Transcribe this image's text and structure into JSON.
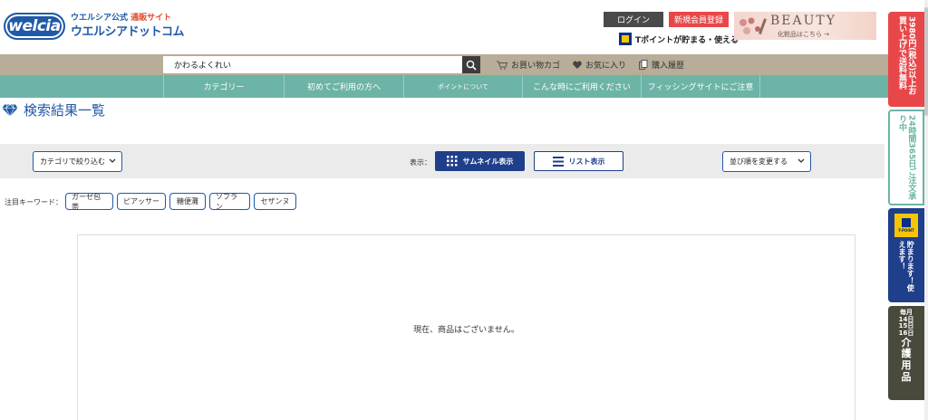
{
  "header": {
    "logo_badge": "welcia",
    "logo_sub_a": "ウエルシア公式",
    "logo_sub_b": "通販サイト",
    "logo_main": "ウエルシアドットコム",
    "login": "ログイン",
    "register": "新規会員登録",
    "tpoint": "Tポイントが貯まる・使える",
    "beauty_title": "BEAUTY",
    "beauty_sub": "化粧品はこちら →"
  },
  "search": {
    "value": "かわるよくれい",
    "cart": "お買い物カゴ",
    "favorites": "お気に入り",
    "history": "購入履歴"
  },
  "nav": {
    "items": [
      {
        "label": "カテゴリー"
      },
      {
        "label": "初めてご利用の方へ"
      },
      {
        "label": "ポイントについて"
      },
      {
        "label": "こんな時にご利用ください"
      },
      {
        "label": "フィッシングサイトにご注意"
      }
    ]
  },
  "main": {
    "title": "検索結果一覧",
    "category_filter": "カテゴリで絞り込む",
    "view_label": "表示：",
    "view_thumbnail": "サムネイル表示",
    "view_list": "リスト表示",
    "sort": "並び順を変更する",
    "keyword_label": "注目キーワード：",
    "keywords": [
      "ガーゼ包帯",
      "ピアッサー",
      "糖便灘",
      "ソフラン",
      "セザンヌ"
    ],
    "empty_message": "現在、商品はございません。"
  },
  "side": {
    "red": "3980円(税込)以上お買い上げで送料無料",
    "green": "24時間365日ご注文承り中",
    "blue_logo": "T-POINT",
    "blue": "貯まります！使えます！",
    "dark_small": "毎月14日15日16日",
    "dark_big": "介護用品"
  },
  "colors": {
    "brand_blue": "#1f5aa8",
    "nav_green": "#6cb4a6",
    "search_strip": "#b7ad98",
    "register_red": "#e8474a",
    "button_navy": "#1f3f8a"
  }
}
